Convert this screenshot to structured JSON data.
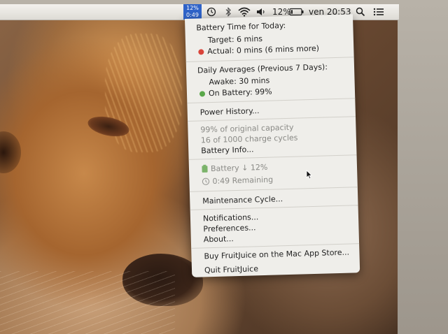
{
  "menubar": {
    "fruitjuice_status": {
      "percent": "12%",
      "time": "0:49"
    },
    "battery_percent": "12%",
    "clock": "ven 20:53",
    "icons": [
      "time-machine-icon",
      "bluetooth-icon",
      "wifi-icon",
      "volume-icon",
      "battery-icon",
      "spotlight-icon",
      "notification-center-icon"
    ]
  },
  "menu": {
    "battery_time": {
      "header": "Battery Time for Today:",
      "target": "Target: 6 mins",
      "actual": "Actual: 0 mins (6 mins more)",
      "actual_status_color": "#d9443a"
    },
    "daily_averages": {
      "header": "Daily Averages (Previous 7 Days):",
      "awake": "Awake: 30 mins",
      "on_battery": "On Battery: 99%",
      "on_battery_status_color": "#5aa84a"
    },
    "power_history": "Power History...",
    "battery_health": {
      "capacity": "99% of original capacity",
      "cycles": "16 of 1000 charge cycles",
      "battery_info": "Battery Info..."
    },
    "battery_status": {
      "charge": "Battery ↓ 12%",
      "remaining": "0:49 Remaining"
    },
    "maintenance_cycle": "Maintenance Cycle...",
    "notifications": "Notifications...",
    "preferences": "Preferences...",
    "about": "About...",
    "buy": "Buy FruitJuice on the Mac App Store...",
    "quit": "Quit FruitJuice"
  }
}
